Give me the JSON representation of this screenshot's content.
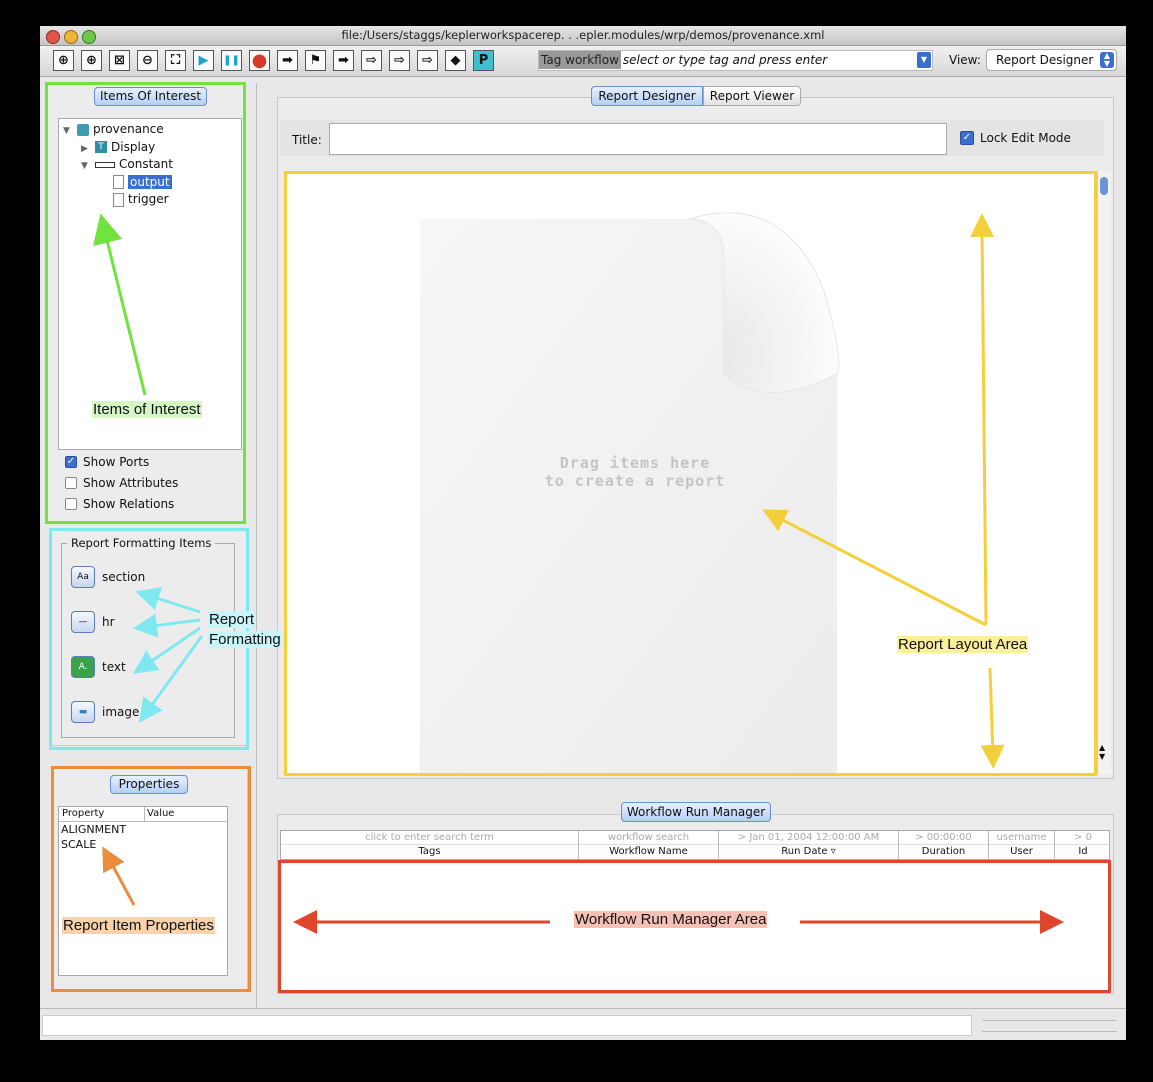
{
  "window": {
    "title": "file:/Users/staggs/keplerworkspacerep. . .epler.modules/wrp/demos/provenance.xml"
  },
  "toolbar": {
    "buttons": [
      {
        "name": "zoom-in-icon",
        "glyph": "⊕"
      },
      {
        "name": "zoom-reset-icon",
        "glyph": "⊕"
      },
      {
        "name": "zoom-fit-icon",
        "glyph": "⊠"
      },
      {
        "name": "zoom-out-icon",
        "glyph": "⊖"
      },
      {
        "name": "full-screen-icon",
        "glyph": "⛶"
      },
      {
        "name": "run-icon",
        "glyph": "▶"
      },
      {
        "name": "pause-icon",
        "glyph": "❚❚"
      },
      {
        "name": "stop-icon",
        "glyph": "●"
      },
      {
        "name": "arrow-right-icon",
        "glyph": "➡"
      },
      {
        "name": "flag-icon",
        "glyph": "⚑"
      },
      {
        "name": "arrow-left-right-icon",
        "glyph": "➡"
      },
      {
        "name": "hollow-arrow-icon",
        "glyph": "⇨"
      },
      {
        "name": "hollow-flag-icon",
        "glyph": "⇨"
      },
      {
        "name": "hollow-double-arrow-icon",
        "glyph": "⇨"
      },
      {
        "name": "diamond-icon",
        "glyph": "◆"
      },
      {
        "name": "p-icon",
        "glyph": "P"
      }
    ],
    "tag_label_highlight": "Tag workflow",
    "tag_placeholder": "select or type tag and press enter",
    "view_label": "View:",
    "view_value": "Report Designer"
  },
  "items_of_interest": {
    "header": "Items Of Interest",
    "tree": [
      {
        "label": "provenance",
        "indent": 0,
        "expander": "▼",
        "icon": "actor-icon"
      },
      {
        "label": "Display",
        "indent": 1,
        "expander": "▶",
        "icon": "text-display-icon"
      },
      {
        "label": "Constant",
        "indent": 1,
        "expander": "▼",
        "icon": "constant-icon"
      },
      {
        "label": "output",
        "indent": 2,
        "expander": "",
        "icon": "document-icon",
        "selected": true
      },
      {
        "label": "trigger",
        "indent": 2,
        "expander": "",
        "icon": "document-icon"
      }
    ],
    "show_ports": "Show Ports",
    "show_ports_checked": true,
    "show_attributes": "Show Attributes",
    "show_attributes_checked": false,
    "show_relations": "Show Relations",
    "show_relations_checked": false
  },
  "formatting": {
    "legend": "Report Formatting Items",
    "items": [
      {
        "label": "section",
        "icon": "section-icon",
        "glyph": "Aa"
      },
      {
        "label": "hr",
        "icon": "hr-icon",
        "glyph": "—"
      },
      {
        "label": "text",
        "icon": "text-icon",
        "glyph": "A."
      },
      {
        "label": "image",
        "icon": "image-icon",
        "glyph": "▬"
      }
    ]
  },
  "properties": {
    "header": "Properties",
    "col_property": "Property",
    "col_value": "Value",
    "rows": [
      "ALIGNMENT",
      "SCALE"
    ]
  },
  "report": {
    "tab_designer": "Report Designer",
    "tab_viewer": "Report Viewer",
    "title_label": "Title:",
    "title_value": "",
    "lock_edit": "Lock Edit Mode",
    "lock_checked": true,
    "drop_line1": "Drag items here",
    "drop_line2": "to create a report"
  },
  "run_manager": {
    "header": "Workflow Run Manager",
    "filters": [
      "click to enter search term",
      "workflow search",
      "> Jan 01, 2004 12:00:00 AM",
      "> 00:00:00",
      "username",
      "> 0"
    ],
    "columns": [
      "Tags",
      "Workflow Name",
      "Run Date ▿",
      "Duration",
      "User",
      "Id"
    ]
  },
  "annotations": {
    "items_of_interest": "Items of Interest",
    "report_formatting_1": "Report",
    "report_formatting_2": "Formatting",
    "report_layout": "Report Layout Area",
    "report_item_properties": "Report Item Properties",
    "run_manager_area": "Workflow Run Manager Area"
  },
  "colors": {
    "green": "#71e33f",
    "cyan": "#7fe9f1",
    "orange": "#ec8d3c",
    "yellow": "#f3d03b",
    "red": "#e0462c",
    "selection": "#3a6fd0"
  }
}
